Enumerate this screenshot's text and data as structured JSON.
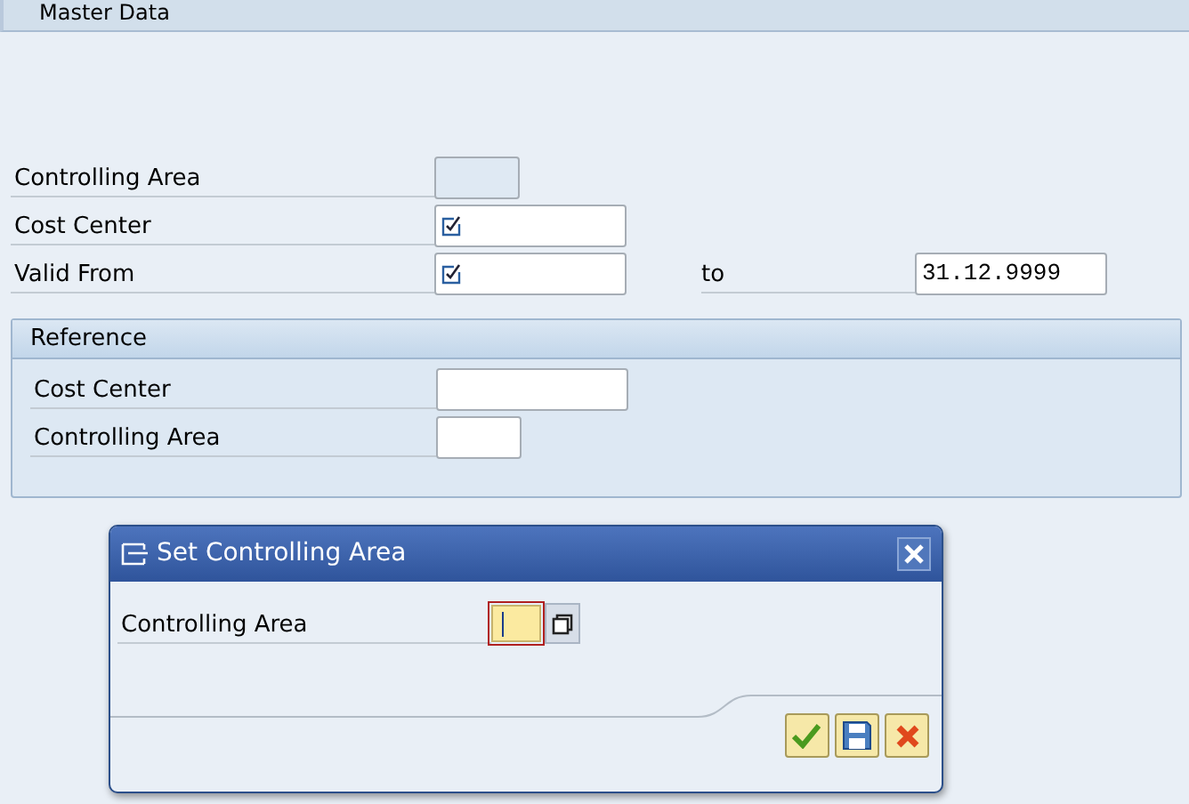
{
  "section_title": "Master Data",
  "fields": [
    {
      "label": "Controlling Area",
      "kind": "disabled"
    },
    {
      "label": "Cost Center",
      "kind": "required"
    },
    {
      "label": "Valid From",
      "kind": "required",
      "to_label": "to",
      "to_value": "31.12.9999"
    }
  ],
  "reference": {
    "title": "Reference",
    "fields": [
      {
        "label": "Cost Center",
        "kind": "text"
      },
      {
        "label": "Controlling Area",
        "kind": "text"
      }
    ]
  },
  "dialog": {
    "title": "Set Controlling Area",
    "field": {
      "label": "Controlling Area",
      "focused": true
    },
    "buttons": [
      {
        "kind": "confirm"
      },
      {
        "kind": "save"
      },
      {
        "kind": "cancel"
      }
    ]
  }
}
